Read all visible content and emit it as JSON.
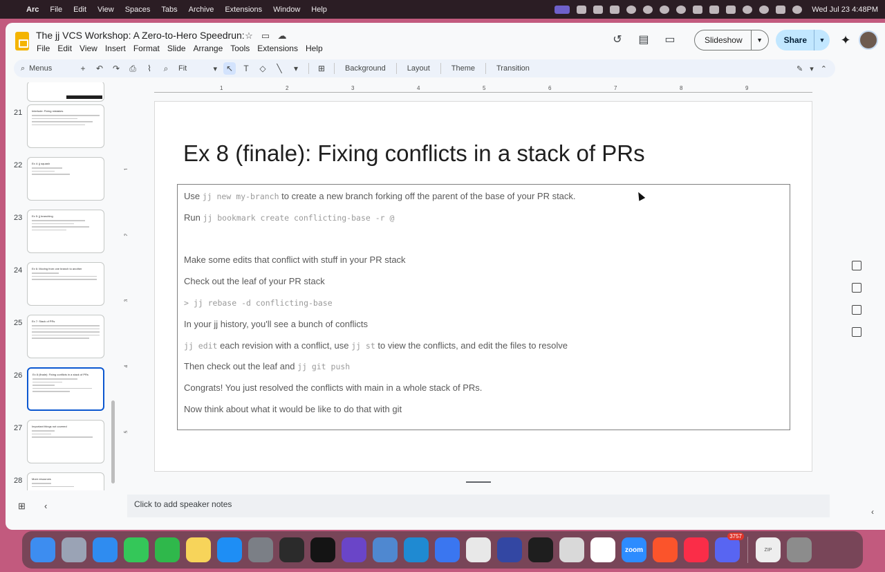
{
  "mac_menubar": {
    "app_name": "Arc",
    "items": [
      "File",
      "Edit",
      "View",
      "Spaces",
      "Tabs",
      "Archive",
      "Extensions",
      "Window",
      "Help"
    ],
    "clock": "Wed Jul 23  4:48PM"
  },
  "doc": {
    "title": "The jj VCS Workshop: A Zero-to-Hero Speedrun:",
    "menus": [
      "File",
      "Edit",
      "View",
      "Insert",
      "Format",
      "Slide",
      "Arrange",
      "Tools",
      "Extensions",
      "Help"
    ],
    "slideshow_label": "Slideshow",
    "share_label": "Share"
  },
  "toolbar": {
    "menus_label": "Menus",
    "zoom_value": "Fit",
    "background_label": "Background",
    "layout_label": "Layout",
    "theme_label": "Theme",
    "transition_label": "Transition"
  },
  "ruler": {
    "horizontal": [
      "1",
      "2",
      "3",
      "4",
      "5",
      "6",
      "7",
      "8",
      "9"
    ],
    "vertical": [
      "1",
      "2",
      "3",
      "4",
      "5"
    ]
  },
  "filmstrip": [
    {
      "num": "21",
      "title": "Interlude: Fixing mistakes"
    },
    {
      "num": "22",
      "title": "Ex 4: jj squash"
    },
    {
      "num": "23",
      "title": "Ex 5: jj branching"
    },
    {
      "num": "24",
      "title": "Ex 6: Moving from one branch to another"
    },
    {
      "num": "25",
      "title": "Ex 7: Stack of PRs"
    },
    {
      "num": "26",
      "title": "Ex 8 (finale): Fixing conflicts in a stack of PRs"
    },
    {
      "num": "27",
      "title": "Important things not covered"
    },
    {
      "num": "28",
      "title": "More resources"
    }
  ],
  "slide": {
    "title": "Ex 8 (finale): Fixing conflicts in a stack of PRs",
    "lines": [
      {
        "pre": "Use ",
        "code": "jj new my-branch",
        "post": " to create a new branch forking off the parent of the base of your PR stack."
      },
      {
        "pre": "Run ",
        "code": "jj bookmark create conflicting-base -r @",
        "post": ""
      },
      {
        "pre": "Make some edits that conflict with stuff in your PR stack",
        "code": "",
        "post": ""
      },
      {
        "pre": "Check out the leaf of your PR stack",
        "code": "",
        "post": ""
      },
      {
        "pre": "",
        "code": "> jj rebase -d conflicting-base",
        "post": ""
      },
      {
        "pre": "In your jj history, you'll see a bunch of conflicts",
        "code": "",
        "post": ""
      },
      {
        "pre": "",
        "code": "jj edit",
        "post": " each revision with a conflict, use ",
        "code2": "jj st",
        "post2": " to view the conflicts, and edit the files to resolve"
      },
      {
        "pre": "Then check out the leaf and ",
        "code": "jj git push",
        "post": ""
      },
      {
        "pre": "Congrats! You just resolved the conflicts with main in a whole stack of PRs.",
        "code": "",
        "post": ""
      },
      {
        "pre": "Now think about what it would be like to do that with git",
        "code": "",
        "post": ""
      }
    ]
  },
  "notes": {
    "placeholder": "Click to add speaker notes"
  },
  "dock": {
    "apps": [
      {
        "name": "finder",
        "color": "#3d8df0"
      },
      {
        "name": "launchpad",
        "color": "#9aa3b5"
      },
      {
        "name": "safari",
        "color": "#2f8cf0"
      },
      {
        "name": "messages",
        "color": "#34c759"
      },
      {
        "name": "facetime",
        "color": "#2fb84b"
      },
      {
        "name": "notes",
        "color": "#f7d45a"
      },
      {
        "name": "app-store",
        "color": "#1e8ef5"
      },
      {
        "name": "system-settings",
        "color": "#7b7f86"
      },
      {
        "name": "arc-layers",
        "color": "#2b2b2b"
      },
      {
        "name": "cursor",
        "color": "#141414"
      },
      {
        "name": "orb",
        "color": "#6a45c8"
      },
      {
        "name": "proxyman",
        "color": "#4f88d0"
      },
      {
        "name": "vscode",
        "color": "#1f8ad2"
      },
      {
        "name": "signal",
        "color": "#3a76f0"
      },
      {
        "name": "chrome",
        "color": "#e8e8e8"
      },
      {
        "name": "affinity",
        "color": "#3347a3"
      },
      {
        "name": "terminal",
        "color": "#1e1e1e"
      },
      {
        "name": "script-editor",
        "color": "#d9d9d9"
      },
      {
        "name": "notion",
        "color": "#ffffff"
      },
      {
        "name": "zoom",
        "color": "#2d8cff"
      },
      {
        "name": "brave",
        "color": "#fb542b"
      },
      {
        "name": "music",
        "color": "#fa2d48"
      },
      {
        "name": "discord",
        "color": "#5865f2"
      }
    ],
    "discord_badge": "3757",
    "zoom_label": "zoom",
    "zip_label": "ZIP"
  }
}
